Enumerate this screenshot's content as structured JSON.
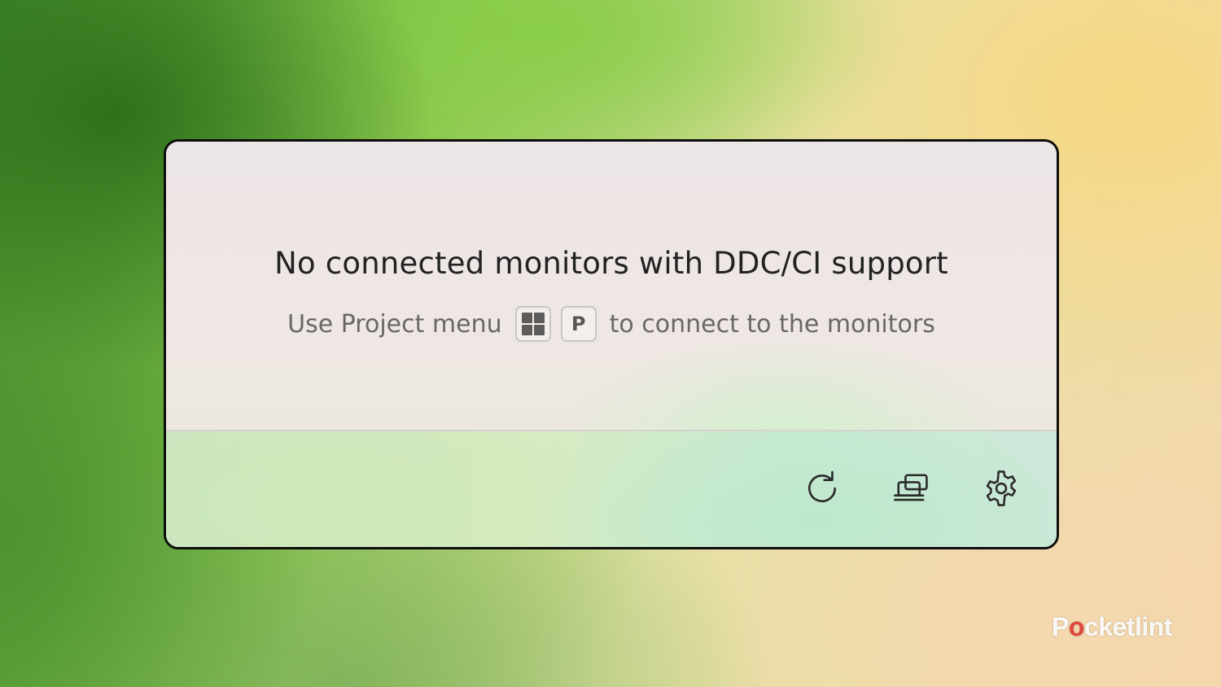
{
  "message": {
    "title": "No connected monitors with DDC/CI support",
    "subtitle_before": "Use Project menu",
    "subtitle_after": "to connect to the monitors",
    "shortcut_keys": [
      {
        "icon": "windows-logo-icon"
      },
      {
        "label": "P"
      }
    ]
  },
  "toolbar": {
    "buttons": [
      {
        "icon": "refresh-icon"
      },
      {
        "icon": "project-displays-icon"
      },
      {
        "icon": "gear-icon"
      }
    ]
  },
  "watermark": {
    "prefix": "P",
    "mark": "o",
    "suffix": "cketlint"
  },
  "colors": {
    "panel_border": "#0d0d0d",
    "title_text": "#222222",
    "subtitle_text": "#6a6865",
    "watermark_accent": "#e0463b"
  }
}
